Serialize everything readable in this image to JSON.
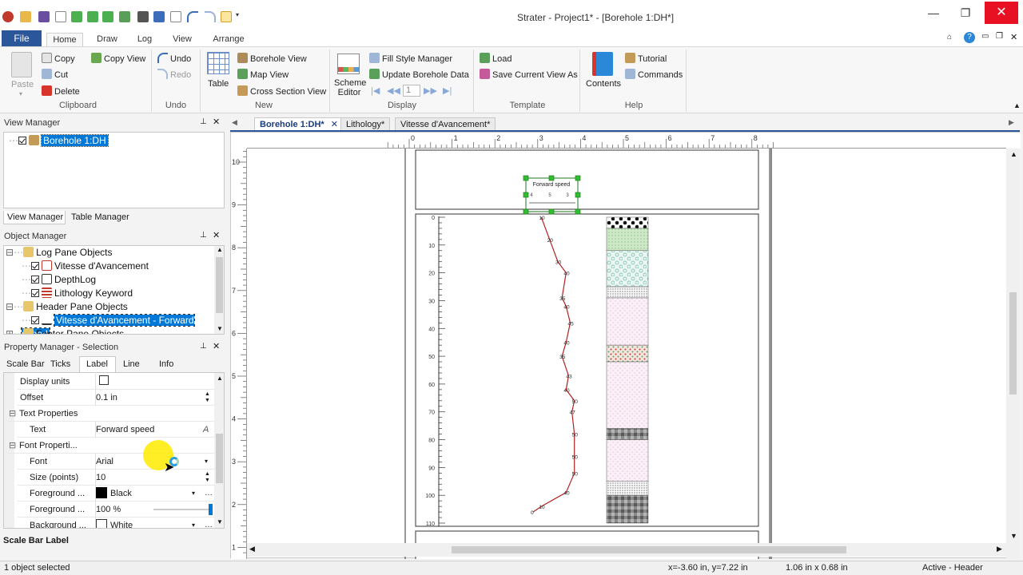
{
  "window": {
    "title": "Strater - Project1* - [Borehole 1:DH*]"
  },
  "ribbon_tabs": [
    "File",
    "Home",
    "Draw",
    "Log",
    "View",
    "Arrange"
  ],
  "clipboard": {
    "paste": "Paste",
    "copy": "Copy",
    "cut": "Cut",
    "delete": "Delete",
    "copy_view": "Copy View",
    "group": "Clipboard"
  },
  "undo": {
    "undo": "Undo",
    "redo": "Redo",
    "group": "Undo"
  },
  "new_group": {
    "table": "Table",
    "borehole_view": "Borehole View",
    "map_view": "Map View",
    "cross_section_view": "Cross Section View",
    "group": "New"
  },
  "display": {
    "scheme_editor": "Scheme Editor",
    "fill_style_manager": "Fill Style Manager",
    "update_borehole_data": "Update Borehole Data",
    "page": "1",
    "group": "Display"
  },
  "template": {
    "load": "Load",
    "save_current_view": "Save Current View As",
    "group": "Template"
  },
  "help": {
    "contents": "Contents",
    "tutorial": "Tutorial",
    "commands": "Commands",
    "group": "Help"
  },
  "view_manager": {
    "title": "View Manager",
    "item": "Borehole 1:DH",
    "tabs": [
      "View Manager",
      "Table Manager"
    ]
  },
  "object_manager": {
    "title": "Object Manager",
    "items": [
      "Log Pane Objects",
      "Vitesse d'Avancement",
      "DepthLog",
      "Lithology Keyword",
      "Header Pane Objects",
      "Vitesse d'Avancement - Forward speed",
      "Footer Pane Objects"
    ]
  },
  "property_manager": {
    "title": "Property Manager - Selection",
    "tabs": [
      "Scale Bar",
      "Ticks",
      "Label",
      "Line",
      "Info"
    ],
    "rows": [
      {
        "key": "Display units",
        "value": ""
      },
      {
        "key": "Offset",
        "value": "0.1 in"
      },
      {
        "key": "Text Properties",
        "value": ""
      },
      {
        "key": "Text",
        "value": "Forward speed"
      },
      {
        "key": "Font Properti...",
        "value": ""
      },
      {
        "key": "Font",
        "value": "Arial"
      },
      {
        "key": "Size (points)",
        "value": "10"
      },
      {
        "key": "Foreground ...",
        "value": "Black"
      },
      {
        "key": "Foreground ...",
        "value": "100 %"
      },
      {
        "key": "Background ...",
        "value": "White"
      }
    ],
    "footer": "Scale Bar Label"
  },
  "doc_tabs": [
    "Borehole 1:DH*",
    "Lithology*",
    "Vitesse d'Avancement*"
  ],
  "ruler": {
    "h": [
      "0",
      "1",
      "2",
      "3",
      "4",
      "5",
      "6",
      "7",
      "8"
    ],
    "v": [
      "10",
      "9",
      "8",
      "7",
      "6",
      "5",
      "4",
      "3",
      "2",
      "1"
    ]
  },
  "header_label": "Forward speed",
  "header_ticks": [
    "4",
    "5",
    "3"
  ],
  "depth_ticks": [
    "0",
    "10",
    "20",
    "30",
    "40",
    "50",
    "60",
    "70",
    "80",
    "90",
    "100",
    "110"
  ],
  "chart_data": {
    "type": "line",
    "x": [
      10,
      20,
      30,
      40,
      35,
      40,
      45,
      40,
      35,
      43,
      40,
      50,
      47,
      50,
      50,
      50,
      40,
      10,
      0
    ],
    "y": [
      0,
      8,
      16,
      20,
      29,
      32,
      38,
      45,
      50,
      57,
      62,
      66,
      70,
      78,
      86,
      92,
      99,
      104,
      106
    ],
    "labels": [
      "10",
      "20",
      "30",
      "40",
      "35",
      "40",
      "45",
      "40",
      "35",
      "43",
      "40",
      "50",
      "47",
      "50",
      "50",
      "50",
      "40",
      "10",
      "0"
    ],
    "color": "#b22222",
    "xlim": [
      0,
      60
    ],
    "ylim": [
      0,
      110
    ]
  },
  "status": {
    "left": "1 object selected",
    "coords": "x=-3.60 in, y=7.22 in",
    "size": "1.06 in x 0.68 in",
    "mode": "Active - Header"
  }
}
